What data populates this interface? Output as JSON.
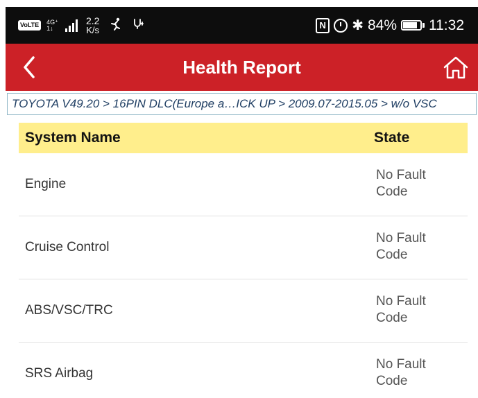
{
  "status_bar": {
    "volte": "VoLTE",
    "network_gen": "4G⁺",
    "network_sub": "1↓",
    "speed_value": "2.2",
    "speed_unit": "K/s",
    "nfc": "N",
    "battery_pct": "84%",
    "battery_level": 0.84,
    "time": "11:32"
  },
  "app_bar": {
    "title": "Health Report",
    "color": "#cc2127"
  },
  "breadcrumb": "TOYOTA V49.20 > 16PIN DLC(Europe a…ICK UP > 2009.07-2015.05 > w/o VSC",
  "table": {
    "headers": {
      "name": "System Name",
      "state": "State"
    },
    "header_color": "#ffee8c",
    "rows": [
      {
        "name": "Engine",
        "state": "No Fault Code"
      },
      {
        "name": "Cruise Control",
        "state": "No Fault Code"
      },
      {
        "name": "ABS/VSC/TRC",
        "state": "No Fault Code"
      },
      {
        "name": "SRS Airbag",
        "state": "No Fault Code"
      }
    ]
  }
}
